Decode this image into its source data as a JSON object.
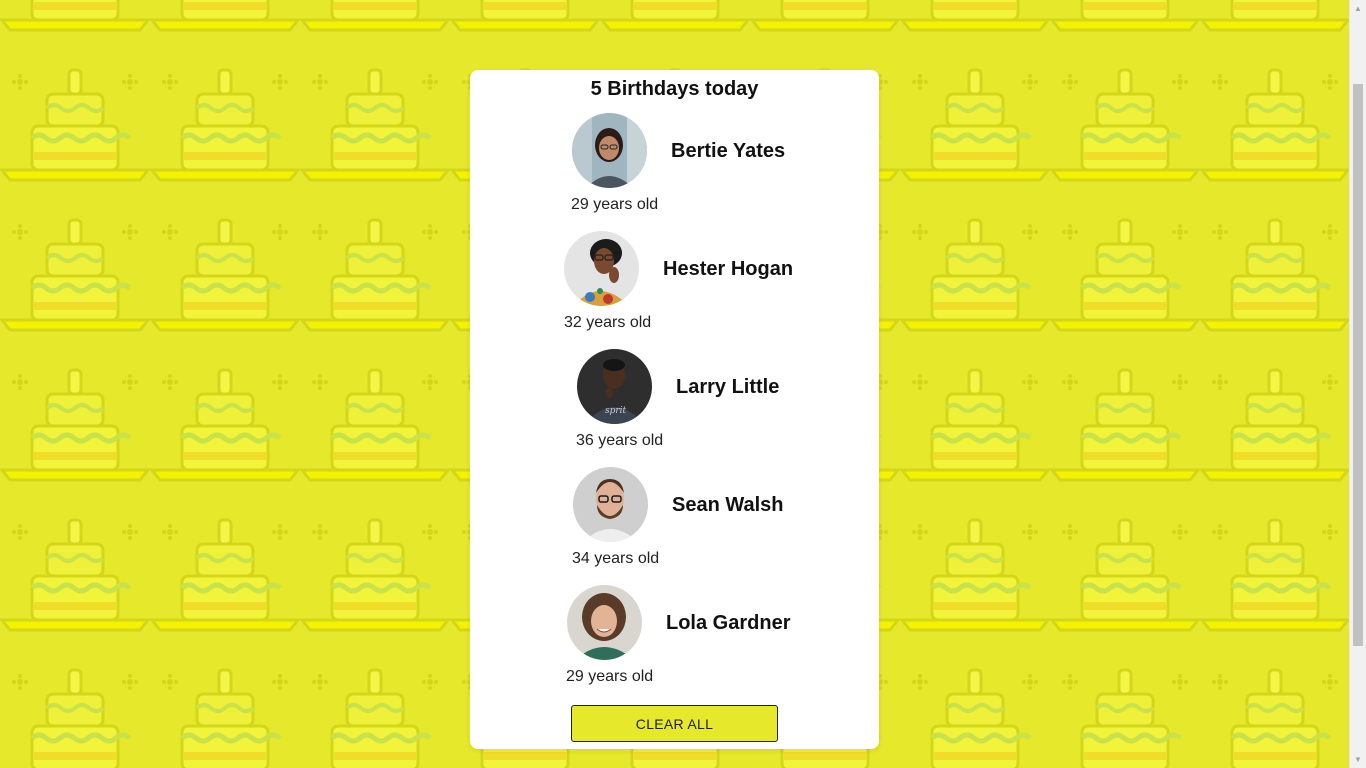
{
  "colors": {
    "background": "#e6e82c",
    "card": "#ffffff",
    "button": "#e6e82c"
  },
  "title": "5 Birthdays today",
  "people": [
    {
      "name": "Bertie Yates",
      "age_label": "29 years old",
      "avatar_icon": "woman-glasses-avatar"
    },
    {
      "name": "Hester Hogan",
      "age_label": "32 years old",
      "avatar_icon": "woman-colorful-shirt-avatar"
    },
    {
      "name": "Larry Little",
      "age_label": "36 years old",
      "avatar_icon": "man-dark-shirt-avatar"
    },
    {
      "name": "Sean Walsh",
      "age_label": "34 years old",
      "avatar_icon": "man-beard-glasses-avatar"
    },
    {
      "name": "Lola Gardner",
      "age_label": "29 years old",
      "avatar_icon": "woman-curly-hair-avatar"
    }
  ],
  "clear_button_label": "CLEAR ALL"
}
